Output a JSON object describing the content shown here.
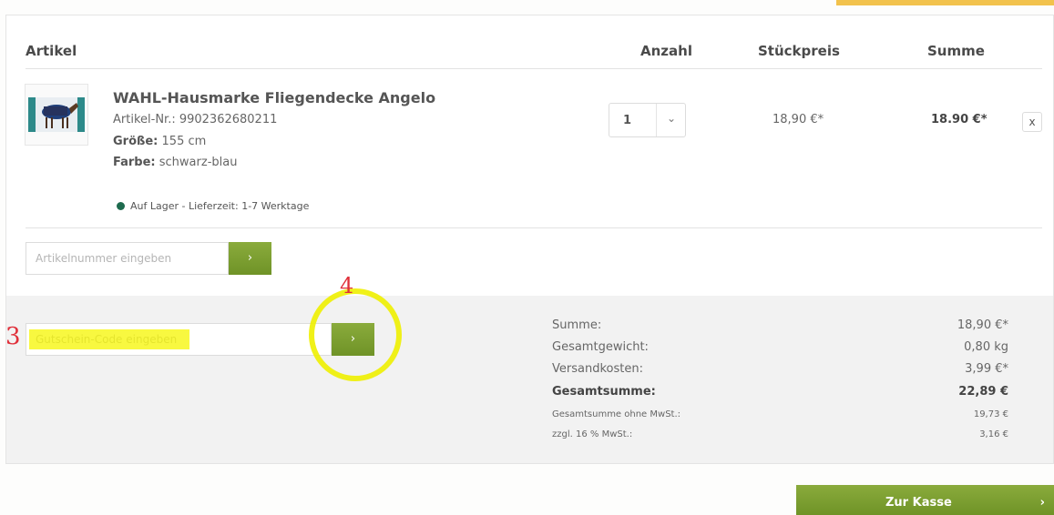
{
  "cart": {
    "columns": {
      "article": "Artikel",
      "quantity": "Anzahl",
      "unit_price": "Stückpreis",
      "total": "Summe"
    },
    "item": {
      "title": "WAHL-Hausmarke Fliegendecke Angelo",
      "article_no": "Artikel-Nr.: 9902362680211",
      "size_label": "Größe:",
      "size_value": "155 cm",
      "color_label": "Farbe:",
      "color_value": "schwarz-blau",
      "stock": "Auf Lager - Lieferzeit: 1-7 Werktage",
      "quantity": "1",
      "unit_price": "18,90 €*",
      "total": "18.90 €*",
      "remove": "x"
    },
    "article_input": {
      "placeholder": "Artikelnummer eingeben",
      "button": "›"
    },
    "voucher_input": {
      "placeholder": "Gutschein-Code eingeben",
      "button": "›"
    }
  },
  "summary": {
    "rows": [
      {
        "label": "Summe:",
        "value": "18,90 €*"
      },
      {
        "label": "Gesamtgewicht:",
        "value": "0,80 kg"
      },
      {
        "label": "Versandkosten:",
        "value": "3,99 €*"
      },
      {
        "label": "Gesamtsumme:",
        "value": "22,89 €"
      },
      {
        "label": "Gesamtsumme ohne MwSt.:",
        "value": "19,73 €"
      },
      {
        "label": "zzgl. 16 % MwSt.:",
        "value": "3,16 €"
      }
    ]
  },
  "checkout": {
    "label": "Zur Kasse",
    "arrow": "›"
  },
  "annotations": {
    "label_3": "3",
    "label_4": "4"
  },
  "colors": {
    "accent_green": "#7a9c2f",
    "top_accent": "#f2c24c",
    "highlight": "#f5f500",
    "annotation_red": "#e0303a"
  }
}
